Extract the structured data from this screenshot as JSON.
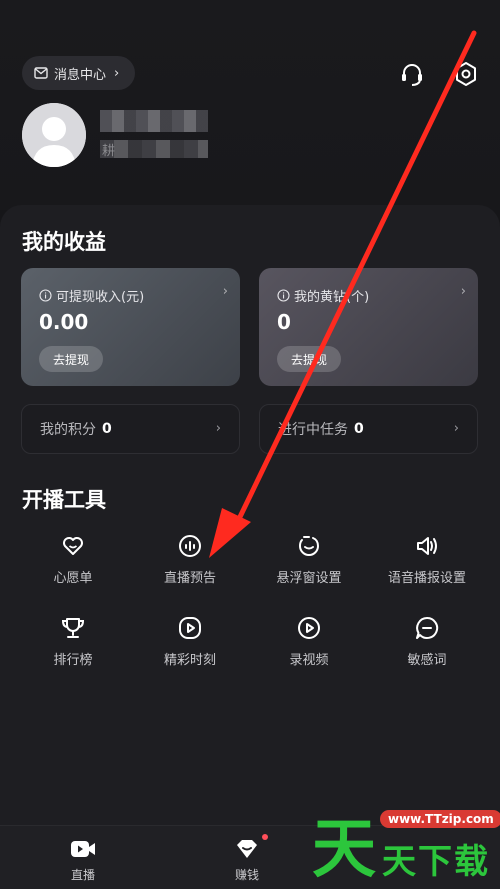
{
  "header": {
    "message_center_label": "消息中心",
    "user_sub_char": "耕"
  },
  "earnings": {
    "title": "我的收益",
    "withdrawable": {
      "label": "可提现收入(元)",
      "value": "0.00",
      "button": "去提现"
    },
    "gold": {
      "label": "我的黄钻(个)",
      "value": "0",
      "button": "去提现"
    },
    "points": {
      "label": "我的积分",
      "value": "0"
    },
    "tasks": {
      "label": "进行中任务",
      "value": "0"
    }
  },
  "tools": {
    "title": "开播工具",
    "items": [
      {
        "label": "心愿单",
        "icon": "heart-icon"
      },
      {
        "label": "直播预告",
        "icon": "live-preview-icon"
      },
      {
        "label": "悬浮窗设置",
        "icon": "floating-window-icon"
      },
      {
        "label": "语音播报设置",
        "icon": "speaker-icon"
      },
      {
        "label": "排行榜",
        "icon": "trophy-icon"
      },
      {
        "label": "精彩时刻",
        "icon": "highlight-play-icon"
      },
      {
        "label": "录视频",
        "icon": "record-video-icon"
      },
      {
        "label": "敏感词",
        "icon": "chat-bubble-icon"
      }
    ]
  },
  "bottom_nav": [
    {
      "label": "直播",
      "icon": "live-camera-icon"
    },
    {
      "label": "赚钱",
      "icon": "earn-icon"
    }
  ],
  "watermark": {
    "url": "www.TTzip.com",
    "main_char": "天",
    "chars": "天下载"
  },
  "colors": {
    "background": "#161619",
    "annotation_arrow": "#ff2a1f",
    "watermark_green": "#2cc63c"
  }
}
